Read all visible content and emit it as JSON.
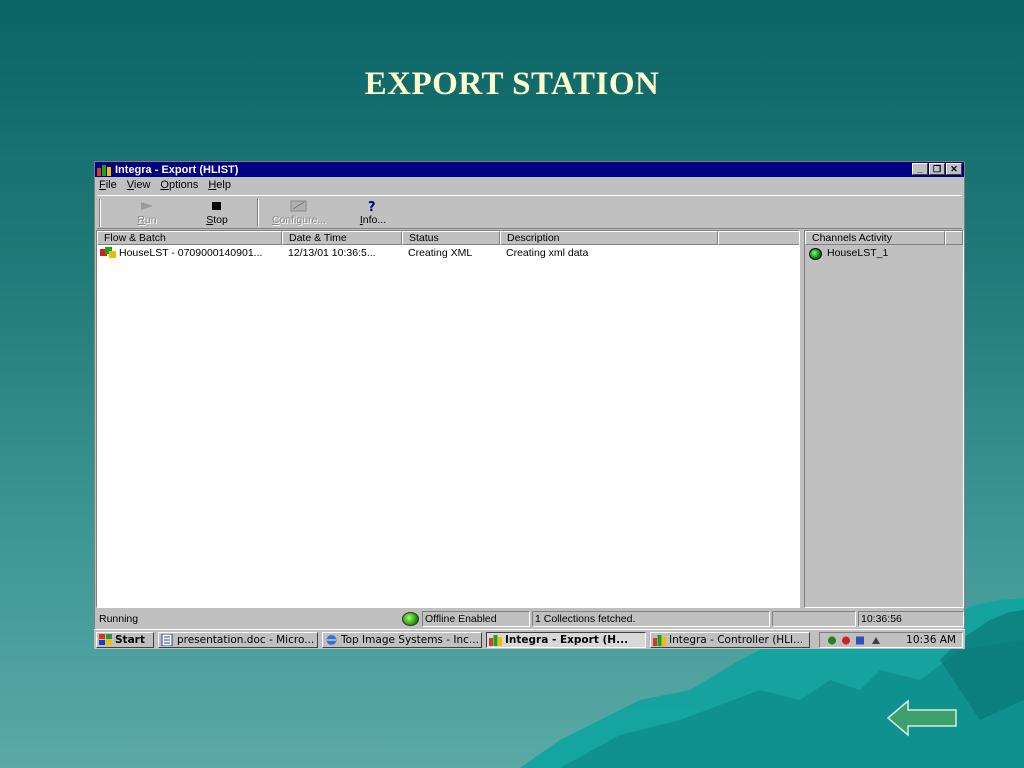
{
  "slide": {
    "title": "EXPORT STATION"
  },
  "window": {
    "title": "Integra - Export (HLIST)",
    "controls": [
      "_",
      "❐",
      "✕"
    ],
    "menu": [
      "File",
      "View",
      "Options",
      "Help"
    ],
    "toolbar": [
      {
        "label": "Run",
        "icon": "run-arrow-icon",
        "enabled": false
      },
      {
        "label": "Stop",
        "icon": "stop-square-icon",
        "enabled": true
      },
      {
        "label": "Configure...",
        "icon": "configure-icon",
        "enabled": false
      },
      {
        "label": "Info...",
        "icon": "question-mark-icon",
        "enabled": true
      }
    ],
    "flow_table": {
      "columns": [
        "Flow & Batch",
        "Date & Time",
        "Status",
        "Description"
      ],
      "rows": [
        {
          "flow": "HouseLST - 0709000140901...",
          "datetime": "12/13/01 10:36:5...",
          "status": "Creating XML",
          "description": "Creating xml data"
        }
      ]
    },
    "channels": {
      "header": "Channels Activity",
      "items": [
        {
          "label": "HouseLST_1",
          "status_color": "#00a000"
        }
      ]
    },
    "statusbar": {
      "state": "Running",
      "mode": "Offline Enabled",
      "message": "1 Collections fetched.",
      "time": "10:36:56"
    }
  },
  "taskbar": {
    "start": "Start",
    "tasks": [
      {
        "label": "presentation.doc - Micro...",
        "active": false
      },
      {
        "label": "Top Image Systems - Inc...",
        "active": false
      },
      {
        "label": "Integra - Export (H...",
        "active": true
      },
      {
        "label": "Integra - Controller (HLI...",
        "active": false
      }
    ],
    "clock": "10:36 AM"
  },
  "colors": {
    "title_bar": "#000080",
    "window_face": "#c0c0c0",
    "slide_title": "#ffffcc",
    "back_arrow": "#3c9f6c"
  }
}
